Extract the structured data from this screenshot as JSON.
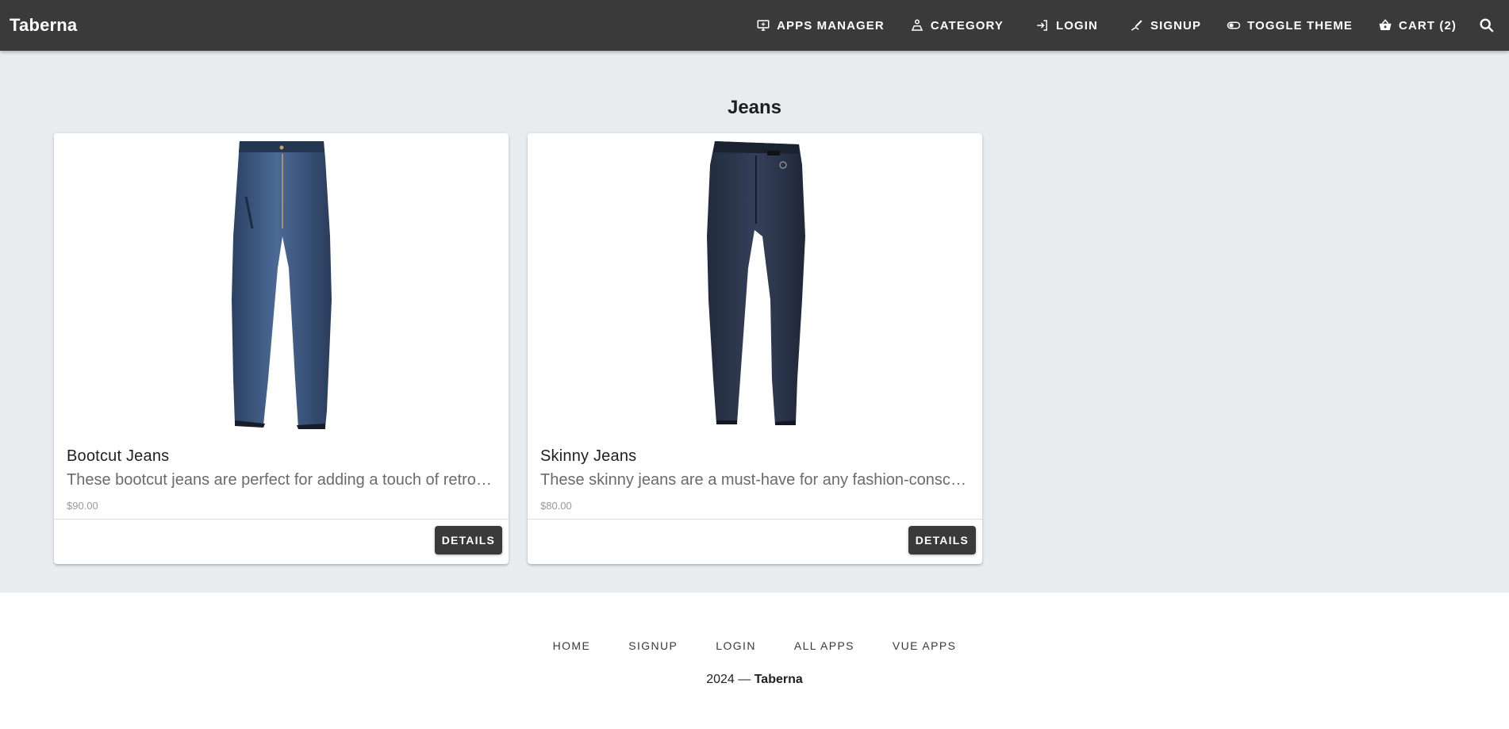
{
  "app": {
    "brand": "Taberna"
  },
  "nav": [
    {
      "label": "Apps Manager",
      "icon": "monitor-icon"
    },
    {
      "label": "Category",
      "icon": "person-icon"
    },
    {
      "label": "Login",
      "icon": "login-icon"
    },
    {
      "label": "Signup",
      "icon": "draw-icon"
    },
    {
      "label": "Toggle Theme",
      "icon": "toggle-icon"
    },
    {
      "label": "Cart (2)",
      "icon": "basket-icon"
    }
  ],
  "search": {
    "icon": "search-icon"
  },
  "page": {
    "title": "Jeans"
  },
  "products": [
    {
      "name": "Bootcut Jeans",
      "description": "These bootcut jeans are perfect for adding a touch of retro flair to your wardrobe.",
      "price": "$90.00",
      "button": "Details",
      "image": "bootcut-jeans-image",
      "color": "#3b5275"
    },
    {
      "name": "Skinny Jeans",
      "description": "These skinny jeans are a must-have for any fashion-conscious wardrobe.",
      "price": "$80.00",
      "button": "Details",
      "image": "skinny-jeans-image",
      "color": "#2b3448"
    }
  ],
  "footer": {
    "links": [
      "Home",
      "Signup",
      "Login",
      "All Apps",
      "Vue Apps"
    ],
    "year": "2024 —",
    "brand": "Taberna"
  },
  "colors": {
    "appbar": "#3a3a3a",
    "background": "#e8ecef",
    "button": "#3a3a3a"
  }
}
